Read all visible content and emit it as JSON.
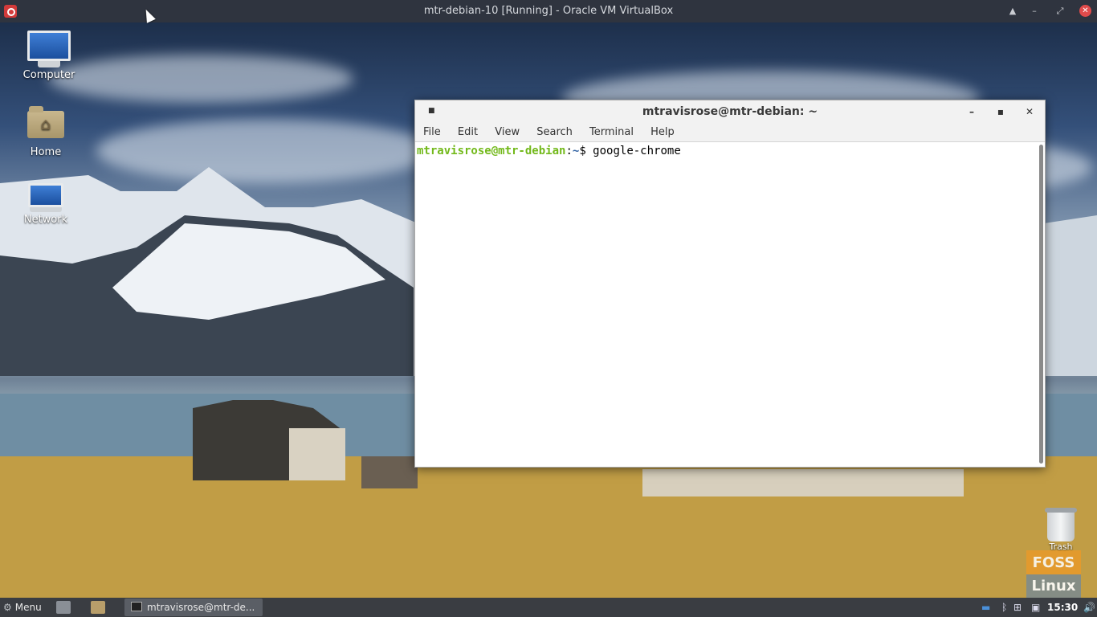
{
  "vbox": {
    "title": "mtr-debian-10 [Running] - Oracle VM VirtualBox",
    "controls": [
      "▲",
      "–",
      "⤢",
      "✕"
    ]
  },
  "desktop": {
    "icons": [
      {
        "label": "Computer"
      },
      {
        "label": "Home"
      },
      {
        "label": "Network"
      }
    ],
    "trash_label": "Trash",
    "watermark": {
      "top": "FOSS",
      "bottom": "Linux"
    }
  },
  "terminal": {
    "title": "mtravisrose@mtr-debian: ~",
    "menu": [
      "File",
      "Edit",
      "View",
      "Search",
      "Terminal",
      "Help"
    ],
    "prompt_user": "mtravisrose@mtr-debian",
    "prompt_sep": ":",
    "prompt_path": "~",
    "prompt_symbol": "$ ",
    "command": "google-chrome",
    "buttons": {
      "minimize": "–",
      "maximize": "▪",
      "close": "✕"
    }
  },
  "panel": {
    "menu_label": "Menu",
    "task_label": "mtravisrose@mtr-de...",
    "clock": "15:30"
  }
}
